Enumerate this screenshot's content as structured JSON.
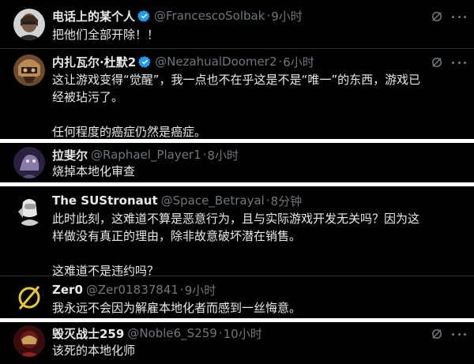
{
  "posts": [
    {
      "name": "电话上的某个人",
      "verified": true,
      "handle": "@FrancescoSolbak",
      "time": "9小时",
      "text": "把他们全部开除！！"
    },
    {
      "name": "内扎瓦尔·杜默2",
      "verified": true,
      "handle": "@NezahualDoomer2",
      "time": "6小时",
      "text": "这让游戏变得“觉醒”，我一点也不在乎这是不是“唯一”的东西，游戏已经被玷污了。\n\n任何程度的癌症仍然是癌症。"
    },
    {
      "name": "拉斐尔",
      "verified": false,
      "handle": "@Raphael_Player1",
      "time": "8小时",
      "text": "烧掉本地化审查"
    },
    {
      "name": "The SUStronaut",
      "verified": false,
      "handle": "@Space_Betrayal",
      "time": "8分钟",
      "text": "此时此刻，这难道不算是恶意行为，且与实际游戏开发无关吗？因为这样做没有真正的理由，除非故意破坏潜在销售。\n\n这难道不是违约吗？"
    },
    {
      "name": "Zer0",
      "verified": false,
      "handle": "@Zer01837841",
      "time": "9小时",
      "text": "我永远不会因为解雇本地化者而感到一丝悔意。"
    },
    {
      "name": "毁灭战士259",
      "verified": false,
      "handle": "@Noble6_S259",
      "time": "10小时",
      "text": "该死的本地化师"
    }
  ],
  "icons": {
    "verified": "verified-badge-icon",
    "grok": "grok-icon",
    "more": "more-options-icon"
  },
  "colors": {
    "background": "#000000",
    "text": "#e7e9ea",
    "muted": "#71767b",
    "verified": "#1d9bf0",
    "divider": "#2f3336"
  }
}
